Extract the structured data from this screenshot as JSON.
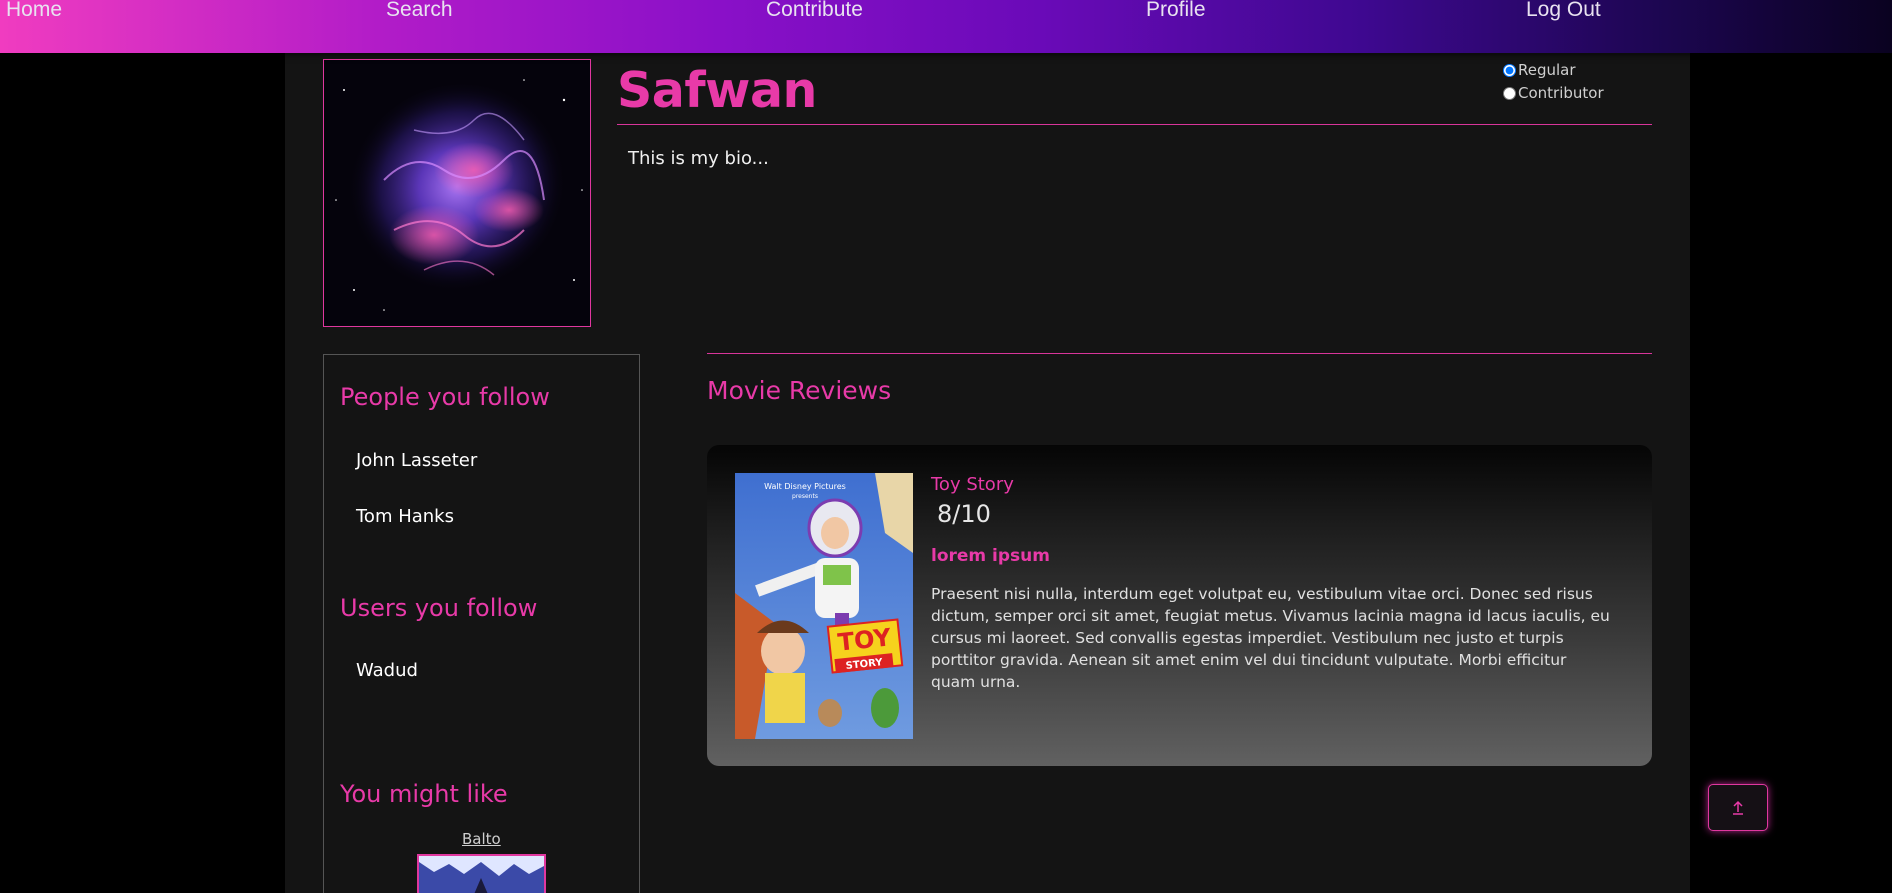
{
  "nav": {
    "home": "Home",
    "search": "Search",
    "contribute": "Contribute",
    "profile": "Profile",
    "logout": "Log Out"
  },
  "profile": {
    "username": "Safwan",
    "bio": "This is my bio...",
    "role_options": [
      "Regular",
      "Contributor"
    ],
    "selected_role": "Regular"
  },
  "sidebar": {
    "people_heading": "People you follow",
    "people": [
      "John Lasseter",
      "Tom Hanks"
    ],
    "users_heading": "Users you follow",
    "users": [
      "Wadud"
    ],
    "recommend_heading": "You might like",
    "recommendations": [
      "Balto"
    ]
  },
  "reviews": {
    "heading": "Movie Reviews",
    "items": [
      {
        "movie": "Toy Story",
        "rating": "8/10",
        "title": "lorem ipsum",
        "body": "Praesent nisi nulla, interdum eget volutpat eu, vestibulum vitae orci. Donec sed risus dictum, semper orci sit amet, feugiat metus. Vivamus lacinia magna id lacus iaculis, eu cursus mi laoreet. Sed convallis egestas imperdiet. Vestibulum nec justo et turpis porttitor gravida. Aenean sit amet enim vel dui tincidunt vulputate. Morbi efficitur quam urna.",
        "poster_text": [
          "Walt Disney Pictures",
          "presents",
          "TOY",
          "STORY"
        ]
      }
    ]
  },
  "colors": {
    "accent": "#e83aa8",
    "page_bg": "#141414",
    "nav_gradient_start": "#f03cc0",
    "nav_gradient_end": "#0a0220"
  },
  "icons": {
    "scroll_top": "arrow-up-icon"
  }
}
